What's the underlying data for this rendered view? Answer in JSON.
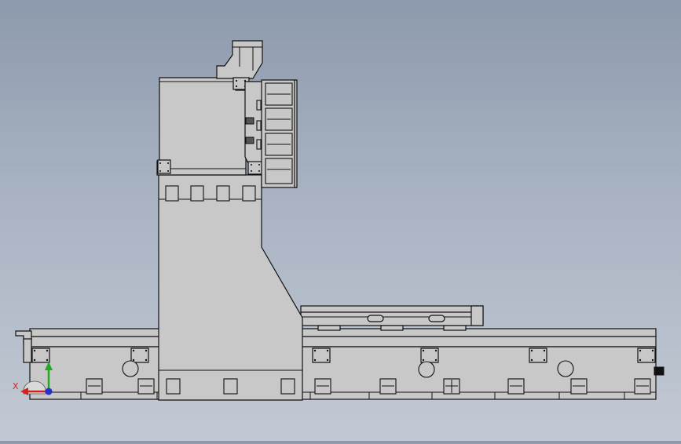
{
  "viewport": {
    "background_top": "#8d9aad",
    "background_bottom": "#c2c9d4",
    "part_fill": "#c8c8c8",
    "edge_color": "#111111"
  },
  "triad": {
    "x_label": "X",
    "x_color": "#d42020",
    "y_color": "#22aa22",
    "z_color": "#2233cc"
  }
}
